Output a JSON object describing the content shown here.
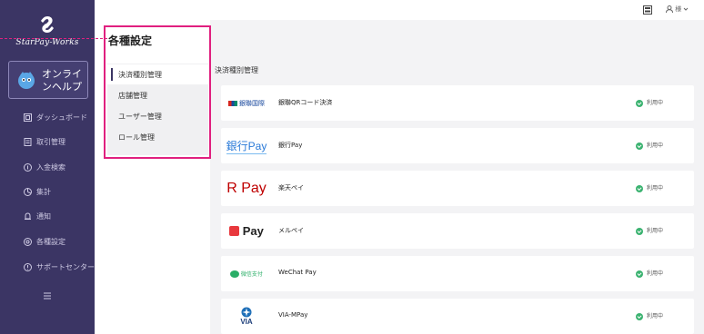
{
  "colors": {
    "sidebar_bg": "#3b3564",
    "highlight": "#e0207f",
    "status_green": "#3cb371",
    "page_bg": "#f3f3f5"
  },
  "sidebar": {
    "logo_text": "StarPay-Works",
    "help_label": "オンライ\nンヘルプ",
    "items": [
      {
        "label": "ダッシュボード",
        "icon": "dashboard-icon"
      },
      {
        "label": "取引管理",
        "icon": "transaction-icon"
      },
      {
        "label": "入金検索",
        "icon": "deposit-search-icon"
      },
      {
        "label": "集計",
        "icon": "aggregate-icon"
      },
      {
        "label": "通知",
        "icon": "bell-icon"
      },
      {
        "label": "各種設定",
        "icon": "settings-icon"
      },
      {
        "label": "サポートセンター",
        "icon": "support-icon"
      }
    ]
  },
  "topbar": {
    "user_label": "様"
  },
  "settings": {
    "title": "各種設定",
    "menu": [
      {
        "label": "決済種別管理",
        "active": true
      },
      {
        "label": "店舗管理",
        "active": false
      },
      {
        "label": "ユーザー管理",
        "active": false
      },
      {
        "label": "ロール管理",
        "active": false
      }
    ]
  },
  "main": {
    "section_title": "決済種別管理",
    "payments": [
      {
        "logo_text": "銀聯国際",
        "name": "銀聯QRコード決済",
        "status": "利用中",
        "logo": "unionpay-logo"
      },
      {
        "logo_text": "銀行Pay",
        "name": "銀行Pay",
        "status": "利用中",
        "logo": "bankpay-logo"
      },
      {
        "logo_text": "R Pay",
        "name": "楽天ペイ",
        "status": "利用中",
        "logo": "rakutenpay-logo"
      },
      {
        "logo_text": "Pay",
        "name": "メルペイ",
        "status": "利用中",
        "logo": "merpay-logo"
      },
      {
        "logo_text": "微信支付",
        "name": "WeChat Pay",
        "status": "利用中",
        "logo": "wechatpay-logo"
      },
      {
        "logo_text": "VIA",
        "name": "VIA-MPay",
        "status": "利用中",
        "logo": "viampay-logo"
      }
    ]
  }
}
